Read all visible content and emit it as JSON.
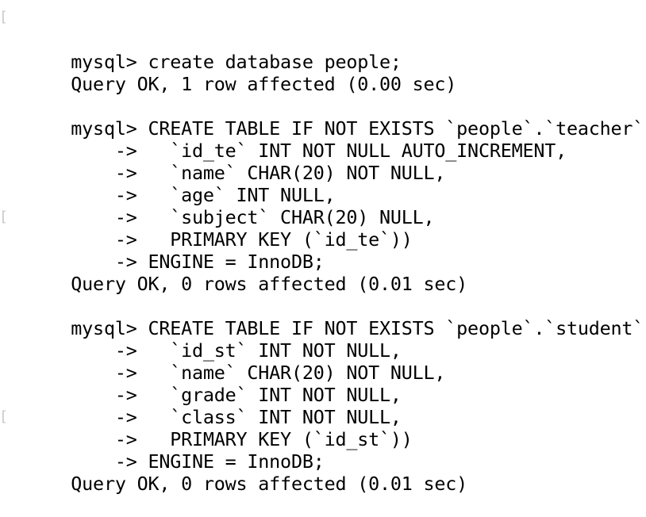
{
  "terminal": {
    "lines": [
      {
        "text": "mysql> create database people;",
        "mark": "["
      },
      {
        "text": "Query OK, 1 row affected (0.00 sec)",
        "mark": ""
      },
      {
        "text": "",
        "mark": ""
      },
      {
        "text": "mysql> CREATE TABLE IF NOT EXISTS `people`.`teacher` (",
        "mark": ""
      },
      {
        "text": "    ->   `id_te` INT NOT NULL AUTO_INCREMENT,",
        "mark": ""
      },
      {
        "text": "    ->   `name` CHAR(20) NOT NULL,",
        "mark": ""
      },
      {
        "text": "    ->   `age` INT NULL,",
        "mark": ""
      },
      {
        "text": "    ->   `subject` CHAR(20) NULL,",
        "mark": ""
      },
      {
        "text": "    ->   PRIMARY KEY (`id_te`))",
        "mark": ""
      },
      {
        "text": "    -> ENGINE = InnoDB;",
        "mark": "["
      },
      {
        "text": "Query OK, 0 rows affected (0.01 sec)",
        "mark": ""
      },
      {
        "text": "",
        "mark": ""
      },
      {
        "text": "mysql> CREATE TABLE IF NOT EXISTS `people`.`student` (",
        "mark": ""
      },
      {
        "text": "    ->   `id_st` INT NOT NULL,",
        "mark": ""
      },
      {
        "text": "    ->   `name` CHAR(20) NOT NULL,",
        "mark": ""
      },
      {
        "text": "    ->   `grade` INT NOT NULL,",
        "mark": ""
      },
      {
        "text": "    ->   `class` INT NOT NULL,",
        "mark": ""
      },
      {
        "text": "    ->   PRIMARY KEY (`id_st`))",
        "mark": ""
      },
      {
        "text": "    -> ENGINE = InnoDB;",
        "mark": "["
      },
      {
        "text": "Query OK, 0 rows affected (0.01 sec)",
        "mark": ""
      }
    ]
  }
}
